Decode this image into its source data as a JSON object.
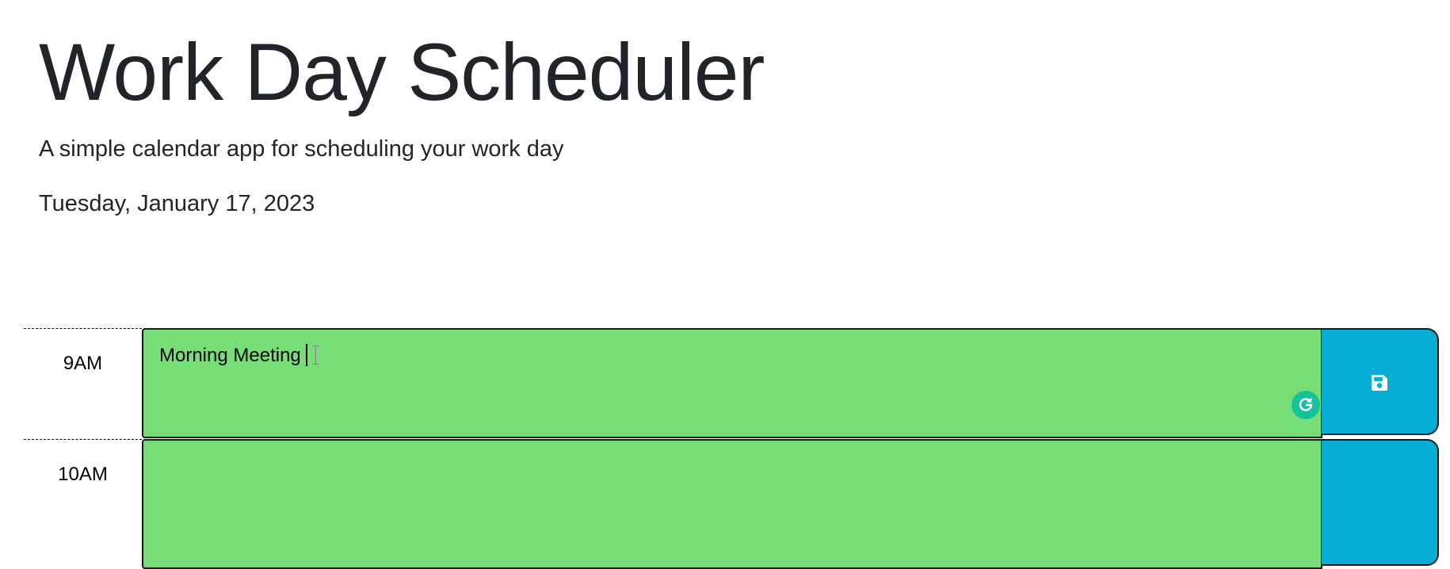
{
  "header": {
    "title": "Work Day Scheduler",
    "lead": "A simple calendar app for scheduling your work day",
    "current_day": "Tuesday, January 17, 2023"
  },
  "time_blocks": [
    {
      "hour": "9AM",
      "description": "Morning Meeting",
      "state": "future",
      "color": "#77dd77"
    },
    {
      "hour": "10AM",
      "description": "",
      "state": "future",
      "color": "#77dd77"
    }
  ],
  "colors": {
    "future": "#77dd77",
    "save_button": "#06aed5",
    "grammarly": "#15c39a",
    "text": "#212529"
  },
  "icons": {
    "save": "save-icon",
    "grammarly": "grammarly-icon"
  }
}
